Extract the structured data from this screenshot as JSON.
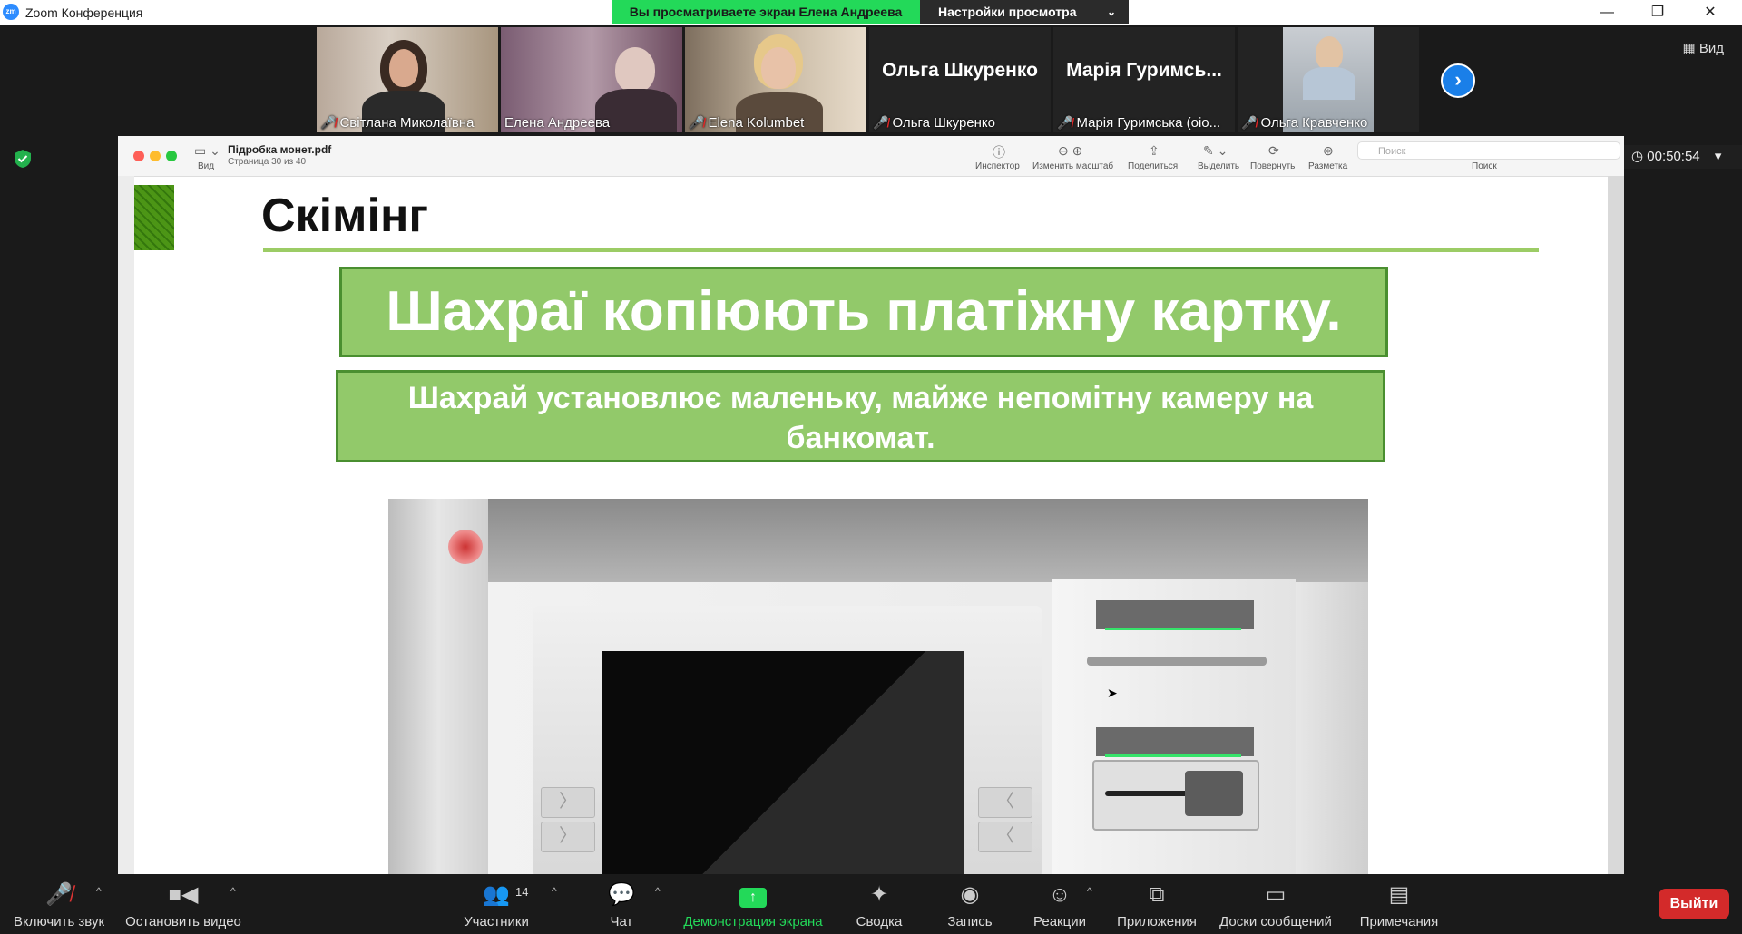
{
  "window": {
    "app_title": "Zoom Конференция",
    "app_icon_text": "zm",
    "share_banner": "Вы просматриваете экран Елена Андреева",
    "view_settings": "Настройки просмотра",
    "view_button": "Вид",
    "timer": "00:50:54"
  },
  "participants": [
    {
      "name": "Світлана Миколаївна",
      "muted": true,
      "video": true
    },
    {
      "name": "Елена Андреева",
      "muted": false,
      "video": true,
      "active": true
    },
    {
      "name": "Elena Kolumbet",
      "muted": true,
      "video": true
    },
    {
      "name": "Ольга Шкуренко",
      "display": "Ольга Шкуренко",
      "muted": true,
      "video": false
    },
    {
      "name": "Марія Гуримська (оіо...",
      "display": "Марія Гуримсь...",
      "muted": true,
      "video": false
    },
    {
      "name": "Ольга Кравченко",
      "muted": true,
      "video": true
    }
  ],
  "preview": {
    "doc_name": "Підробка монет.pdf",
    "doc_page": "Страница 30 из 40",
    "view_label": "Вид",
    "tools": [
      "Инспектор",
      "Изменить масштаб",
      "Поделиться",
      "Выделить",
      "Повернуть",
      "Разметка",
      "Поиск"
    ],
    "search_placeholder": "Поиск"
  },
  "slide": {
    "title": "Скімінг",
    "box1": "Шахраї копіюють платіжну картку.",
    "box2": "Шахрай установлює маленьку, майже непомітну камеру на банкомат."
  },
  "toolbar": {
    "unmute": "Включить звук",
    "stop_video": "Остановить видео",
    "participants": "Участники",
    "participants_count": "14",
    "chat": "Чат",
    "share_screen": "Демонстрация экрана",
    "summary": "Сводка",
    "record": "Запись",
    "reactions": "Реакции",
    "apps": "Приложения",
    "whiteboards": "Доски сообщений",
    "notes": "Примечания",
    "leave": "Выйти"
  },
  "colors": {
    "share_green": "#23d959",
    "slide_green": "#92c96a",
    "leave_red": "#d32a2a",
    "accent_blue": "#1a7fe8"
  }
}
